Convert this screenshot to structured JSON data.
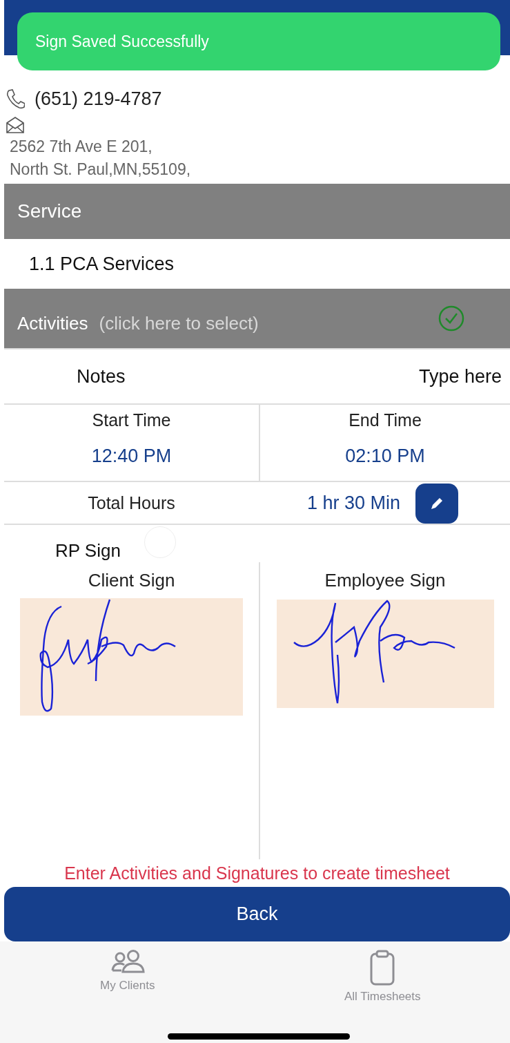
{
  "toast": {
    "message": "Sign Saved Successfully"
  },
  "client": {
    "phone": "(651) 219-4787",
    "address_lines": [
      "2562 7th Ave E 201,",
      "North St. Paul,MN,55109,"
    ]
  },
  "service": {
    "header": "Service",
    "value": "1.1 PCA Services"
  },
  "activities": {
    "label": "Activities",
    "hint": "(click here to select)",
    "done": true
  },
  "notes": {
    "label": "Notes",
    "placeholder": "Type here"
  },
  "times": [
    {
      "label": "Start Time",
      "value": "12:40 PM"
    },
    {
      "label": "End Time",
      "value": "02:10 PM"
    }
  ],
  "total": {
    "label": "Total Hours",
    "value": "1 hr 30 Min"
  },
  "rp_sign": {
    "label": "RP Sign",
    "checked": false
  },
  "signatures": [
    {
      "label": "Client Sign",
      "signed": true
    },
    {
      "label": "Employee Sign",
      "signed": true
    }
  ],
  "warning": "Enter Activities and Signatures to create timesheet",
  "back_button": "Back",
  "tab_bar": [
    {
      "label": "My Clients",
      "kind": "people"
    },
    {
      "label": "All Timesheets",
      "kind": "clipboard"
    }
  ]
}
